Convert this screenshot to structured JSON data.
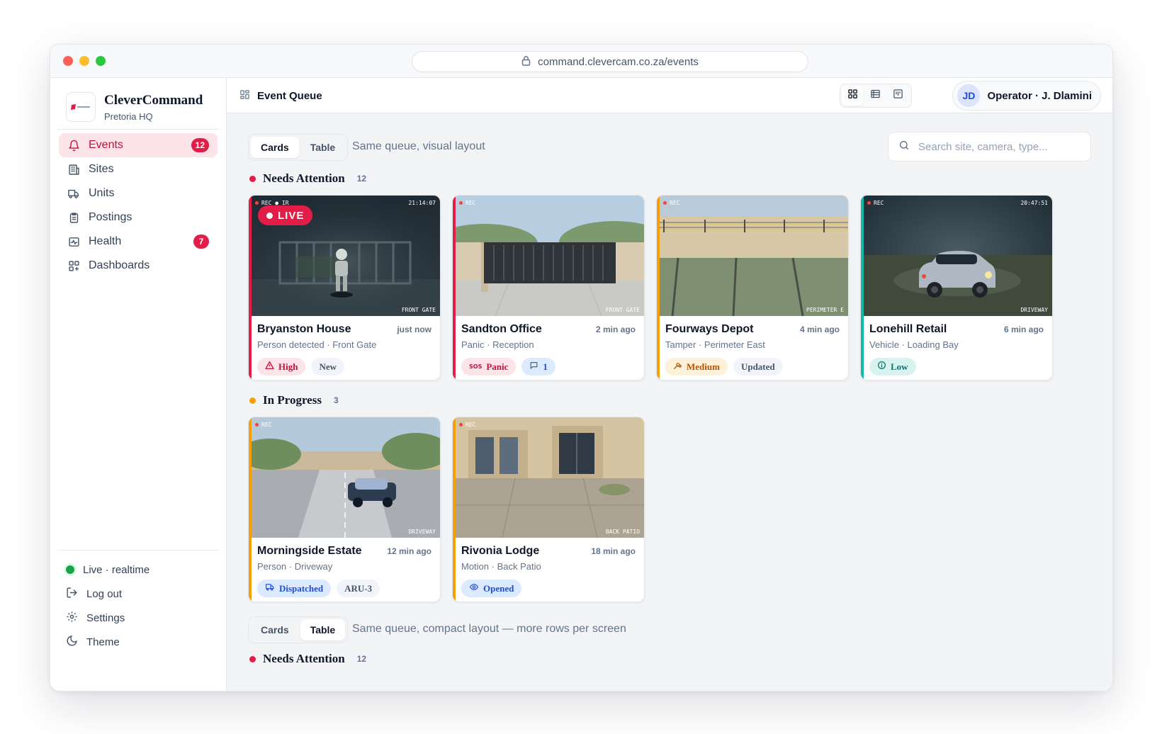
{
  "browser": {
    "url": "command.clevercam.co.za/events"
  },
  "brand": {
    "name": "CleverCommand",
    "subtitle": "Pretoria HQ"
  },
  "nav": [
    {
      "label": "Events",
      "badge": "12",
      "icon": "bell-icon",
      "active": true
    },
    {
      "label": "Sites",
      "icon": "building-icon"
    },
    {
      "label": "Units",
      "icon": "truck-icon"
    },
    {
      "label": "Postings",
      "icon": "clipboard-icon"
    },
    {
      "label": "Health",
      "badge": "7",
      "icon": "activity-icon"
    },
    {
      "label": "Dashboards",
      "icon": "dashboard-icon"
    }
  ],
  "footer": [
    {
      "label": "Live · realtime",
      "icon": "status-dot"
    },
    {
      "label": "Log out",
      "icon": "logout-icon"
    },
    {
      "label": "Settings",
      "icon": "gear-icon"
    },
    {
      "label": "Theme",
      "icon": "moon-icon"
    }
  ],
  "topbar": {
    "title": "Event Queue",
    "user_initials": "JD",
    "user_name": "Operator · J. Dlamini"
  },
  "views": [
    {
      "tabs": [
        "Cards",
        "Table"
      ],
      "active": "Cards",
      "description": "Same queue, visual layout"
    },
    {
      "tabs": [
        "Cards",
        "Table"
      ],
      "active": "Table",
      "description": "Same queue, compact layout — more rows per screen"
    }
  ],
  "search": {
    "placeholder": "Search site, camera, type..."
  },
  "sections": [
    {
      "title": "Needs Attention",
      "count": "12",
      "color": "#e11d48"
    },
    {
      "title": "In Progress",
      "count": "3",
      "color": "#f59e0b"
    },
    {
      "title": "Needs Attention",
      "count": "12",
      "color": "#e11d48"
    }
  ],
  "cards": [
    {
      "title": "Bryanston House",
      "time": "just now",
      "subtitle": "Person detected · Front Gate",
      "accent": "#e11d48",
      "cam_tag": "REC ● IR",
      "cam_time": "21:14:07",
      "cam_location": "FRONT GATE",
      "live_label": "LIVE",
      "chips": [
        {
          "label": "High",
          "icon": "warning-icon"
        },
        {
          "label": "New"
        }
      ]
    },
    {
      "title": "Sandton Office",
      "time": "2 min ago",
      "subtitle": "Panic · Reception",
      "accent": "#e11d48",
      "cam_tag": "REC",
      "cam_location": "FRONT GATE",
      "chips": [
        {
          "label": "Panic",
          "icon": "sos-icon"
        },
        {
          "label": "1",
          "icon": "comment-icon"
        }
      ]
    },
    {
      "title": "Fourways Depot",
      "time": "4 min ago",
      "subtitle": "Tamper · Perimeter East",
      "accent": "#f59e0b",
      "cam_tag": "REC",
      "cam_location": "PERIMETER E",
      "chips": [
        {
          "label": "Medium",
          "icon": "wrench-icon"
        },
        {
          "label": "Updated"
        }
      ]
    },
    {
      "title": "Lonehill Retail",
      "time": "6 min ago",
      "subtitle": "Vehicle · Loading Bay",
      "accent": "#14b8a6",
      "cam_tag": "REC",
      "cam_time": "20:47:51",
      "cam_location": "DRIVEWAY",
      "chips": [
        {
          "label": "Low",
          "icon": "info-icon"
        }
      ]
    },
    {
      "title": "Morningside Estate",
      "time": "12 min ago",
      "subtitle": "Person · Driveway",
      "accent": "#f59e0b",
      "cam_tag": "REC",
      "cam_location": "DRIVEWAY",
      "chips": [
        {
          "label": "Dispatched",
          "icon": "truck-icon"
        },
        {
          "label": "ARU-3"
        }
      ]
    },
    {
      "title": "Rivonia Lodge",
      "time": "18 min ago",
      "subtitle": "Motion · Back Patio",
      "accent": "#f59e0b",
      "cam_tag": "REC",
      "cam_location": "BACK PATIO",
      "chips": [
        {
          "label": "Opened",
          "icon": "eye-icon"
        }
      ]
    }
  ]
}
